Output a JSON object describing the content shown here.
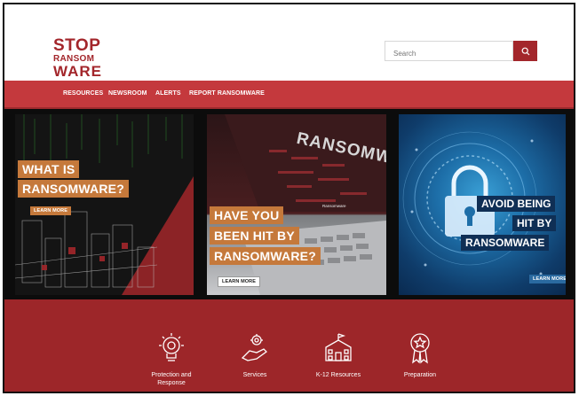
{
  "logo": {
    "line1": "STOP",
    "line2": "RANSOM",
    "line3": "WARE"
  },
  "search": {
    "placeholder": "Search"
  },
  "nav": {
    "items": [
      {
        "label": "RESOURCES"
      },
      {
        "label": "NEWSROOM"
      },
      {
        "label": "ALERTS"
      },
      {
        "label": "REPORT RANSOMWARE"
      }
    ]
  },
  "cards": [
    {
      "lines": [
        "WHAT IS",
        "RANSOMWARE?"
      ],
      "button": "LEARN MORE"
    },
    {
      "watermark": "RANSOMW",
      "screen_text": "Ransomware",
      "lines": [
        "HAVE YOU",
        "BEEN HIT BY",
        "RANSOMWARE?"
      ],
      "button": "LEARN MORE"
    },
    {
      "lines": [
        "AVOID BEING",
        "HIT BY",
        "RANSOMWARE"
      ],
      "button": "LEARN MORE"
    }
  ],
  "services": [
    {
      "label_line1": "Protection and",
      "label_line2": "Response",
      "icon": "lightbulb-gear-icon"
    },
    {
      "label_line1": "Services",
      "label_line2": "",
      "icon": "hand-gear-icon"
    },
    {
      "label_line1": "K-12 Resources",
      "label_line2": "",
      "icon": "school-building-icon"
    },
    {
      "label_line1": "Preparation",
      "label_line2": "",
      "icon": "award-ribbon-icon"
    }
  ],
  "colors": {
    "brand_red": "#a3262b",
    "nav_red": "#c4393d",
    "lower_red": "#9d2629",
    "banner_orange": "#c5793b",
    "banner_navy": "#0f2f55"
  }
}
